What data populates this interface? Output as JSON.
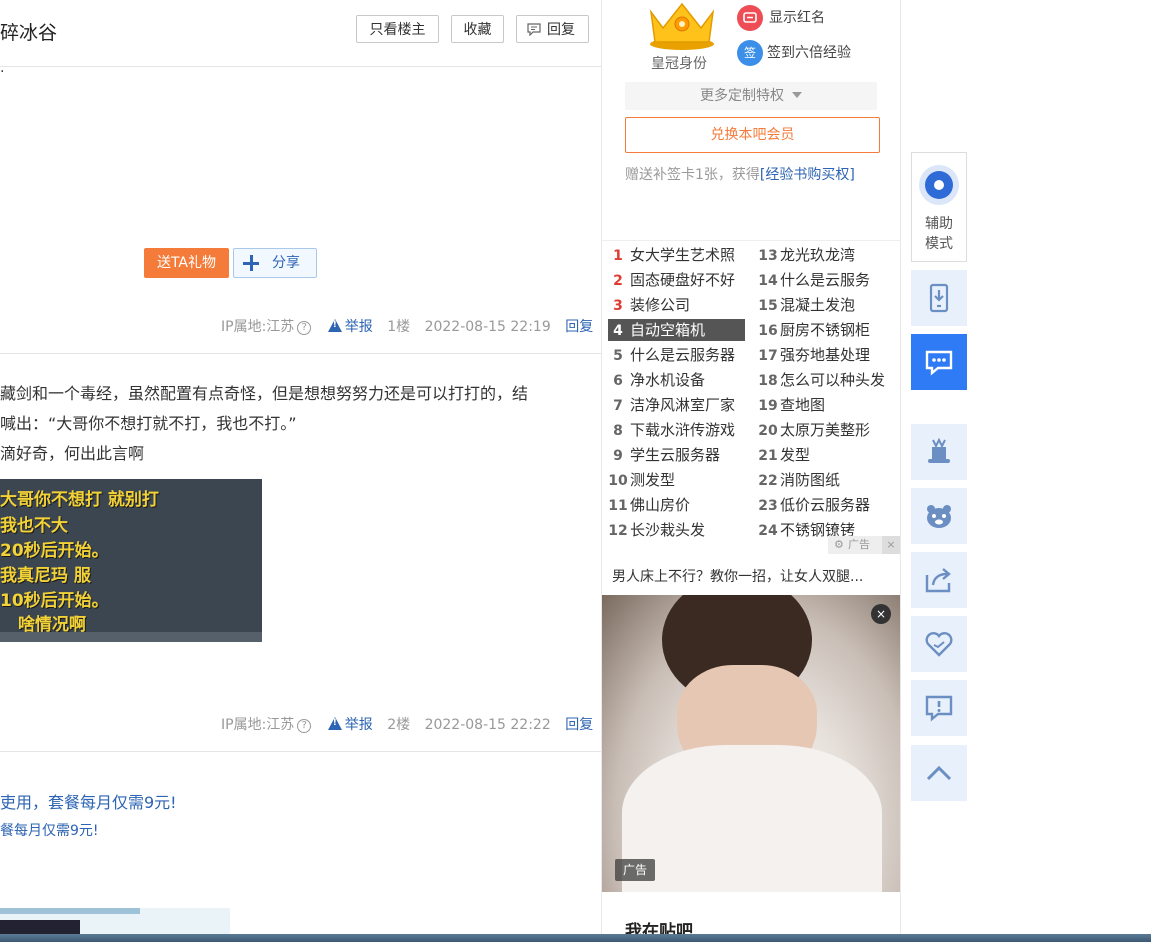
{
  "thread": {
    "title": "碎冰谷",
    "only_op_label": "只看楼主",
    "favorite_label": "收藏",
    "reply_label": "回复"
  },
  "post1": {
    "tick": "·",
    "gift_label": "送TA礼物",
    "share_label": "分享",
    "ip": "IP属地:江苏",
    "help_icon": "?",
    "report": "举报",
    "floor": "1楼",
    "time": "2022-08-15 22:19",
    "reply": "回复"
  },
  "post2": {
    "lines": [
      "藏剑和一个毒经，虽然配置有点奇怪，但是想想努努力还是可以打打的，结",
      "喊出：“大哥你不想打就不打，我也不打。”",
      "滴好奇，何出此言啊"
    ],
    "image_lines": [
      "大哥你不想打 就别打",
      "我也不大",
      "20秒后开始。",
      "我真尼玛 服",
      "10秒后开始。",
      "啥情况啊"
    ],
    "ip": "IP属地:江苏",
    "help_icon": "?",
    "report": "举报",
    "floor": "2楼",
    "time": "2022-08-15 22:22",
    "reply": "回复"
  },
  "post3": {
    "line1": "吏用，套餐每月仅需9元!",
    "line2": "餐每月仅需9元!"
  },
  "member": {
    "crown_label": "皇冠身份",
    "perk1": "显示红名",
    "perk2": "签到六倍经验",
    "perk2_icon_char": "签",
    "more_perks": "更多定制特权",
    "redeem_label": "兑换本吧会员",
    "gift_note_prefix": "赠送补签卡1张，获得",
    "gift_note_link": "[经验书购买权]"
  },
  "hot_list": [
    {
      "rank": "1",
      "text": "女大学生艺术照"
    },
    {
      "rank": "2",
      "text": "固态硬盘好不好"
    },
    {
      "rank": "3",
      "text": "装修公司"
    },
    {
      "rank": "4",
      "text": "自动空箱机"
    },
    {
      "rank": "5",
      "text": "什么是云服务器"
    },
    {
      "rank": "6",
      "text": "净水机设备"
    },
    {
      "rank": "7",
      "text": "洁净风淋室厂家"
    },
    {
      "rank": "8",
      "text": "下载水浒传游戏"
    },
    {
      "rank": "9",
      "text": "学生云服务器"
    },
    {
      "rank": "10",
      "text": "测发型"
    },
    {
      "rank": "11",
      "text": "佛山房价"
    },
    {
      "rank": "12",
      "text": "长沙栽头发"
    },
    {
      "rank": "13",
      "text": "龙光玖龙湾"
    },
    {
      "rank": "14",
      "text": "什么是云服务"
    },
    {
      "rank": "15",
      "text": "混凝土发泡"
    },
    {
      "rank": "16",
      "text": "厨房不锈钢柜"
    },
    {
      "rank": "17",
      "text": "强夯地基处理"
    },
    {
      "rank": "18",
      "text": "怎么可以种头发"
    },
    {
      "rank": "19",
      "text": "查地图"
    },
    {
      "rank": "20",
      "text": "太原万美整形"
    },
    {
      "rank": "21",
      "text": "发型"
    },
    {
      "rank": "22",
      "text": "消防图纸"
    },
    {
      "rank": "23",
      "text": "低价云服务器"
    },
    {
      "rank": "24",
      "text": "不锈钢镣铐"
    }
  ],
  "ad": {
    "tag_label": "广告",
    "close_char": "×",
    "title": "男人床上不行？教你一招，让女人双腿...",
    "badge": "广告"
  },
  "my_tieba": "我在贴吧",
  "sidebar": {
    "assist_line1": "辅助",
    "assist_line2": "模式"
  },
  "colors": {
    "accent_blue": "#2d64b3",
    "orange": "#f47b3a",
    "side_active": "#2f7af5",
    "side_bg": "#e8f0fb"
  }
}
